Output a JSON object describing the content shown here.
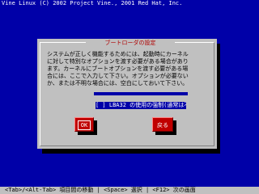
{
  "header": {
    "copyright": "Vine Linux (C) 2002 Project Vine., 2001 Red Hat, Inc."
  },
  "dialog": {
    "title": "ブートローダの設定",
    "message_lines": [
      "システムが正しく機能するためには、起動時にカーネル",
      "に対して特別なオプションを渡す必要がある場合があり",
      "ます。カーネルにブートオプションを渡す必要がある場",
      "合には、ここで入力して下さい。オプションが必要ない",
      "か、または不明な場合には、空白にしておいて下さい。"
    ],
    "option_checkbox": "[ ] LBA32 の使用の強制(通常は不必要)",
    "ok_label": "OK",
    "back_label": "戻る"
  },
  "footer": {
    "hint": "<Tab>/<Alt-Tab> 項目間の移動 | <Space> 選択  |  <F12> 次の画面"
  },
  "colors": {
    "background": "#0000a8",
    "dialog": "#c0c0c0",
    "title_text": "#b00000",
    "button": "#c00000"
  }
}
